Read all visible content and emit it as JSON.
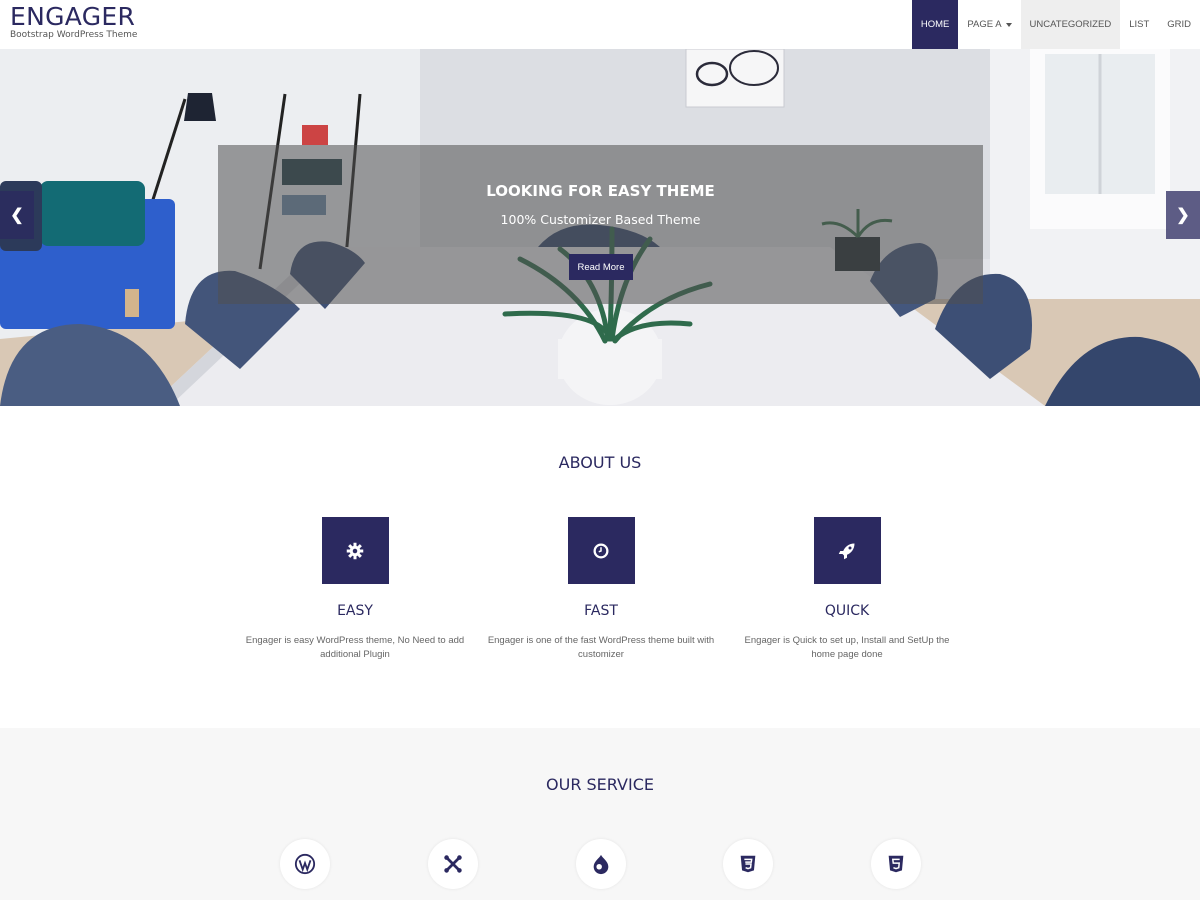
{
  "header": {
    "brand_title": "ENGAGER",
    "brand_subtitle": "Bootstrap WordPress Theme",
    "nav": [
      {
        "label": "HOME"
      },
      {
        "label": "PAGE A"
      },
      {
        "label": "UNCATEGORIZED"
      },
      {
        "label": "LIST"
      },
      {
        "label": "GRID"
      }
    ]
  },
  "hero": {
    "title": "LOOKING FOR EASY THEME",
    "subtitle": "100% Customizer Based Theme",
    "button_label": "Read More",
    "prev_icon": "chevron-left-icon",
    "next_icon": "chevron-right-icon"
  },
  "about": {
    "title": "ABOUT US",
    "features": [
      {
        "icon": "gear-icon",
        "title": "EASY",
        "text": "Engager is easy WordPress theme, No Need to add additional Plugin"
      },
      {
        "icon": "clock-icon",
        "title": "FAST",
        "text": "Engager is one of the fast WordPress theme built with customizer"
      },
      {
        "icon": "rocket-icon",
        "title": "QUICK",
        "text": "Engager is Quick to set up, Install and SetUp the home page done"
      }
    ]
  },
  "service": {
    "title": "OUR SERVICE",
    "icons": [
      "wordpress-icon",
      "joomla-icon",
      "drupal-icon",
      "css3-icon",
      "html5-icon"
    ]
  },
  "colors": {
    "brand": "#2b2960",
    "section_bg": "#f7f7f7"
  }
}
